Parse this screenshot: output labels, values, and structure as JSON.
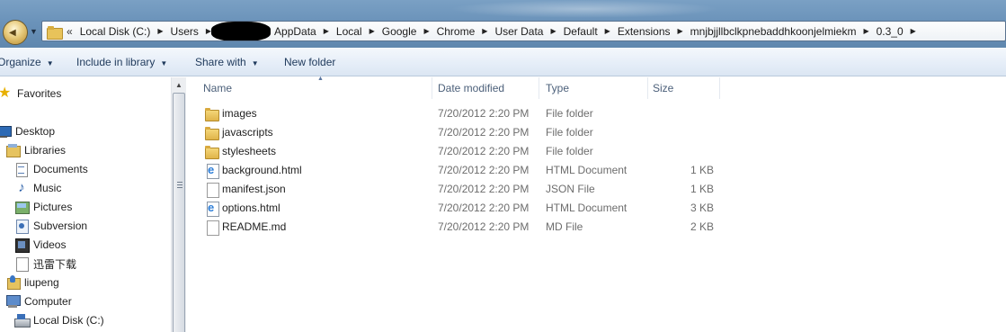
{
  "address": {
    "overflow_glyph": "«",
    "crumbs_before": [
      "Local Disk (C:)",
      "Users"
    ],
    "crumbs_after": [
      "AppData",
      "Local",
      "Google",
      "Chrome",
      "User Data",
      "Default",
      "Extensions",
      "mnjbjjllbclkpnebaddhkoonjelmiekm",
      "0.3_0"
    ],
    "separator": "▶"
  },
  "toolbar": {
    "organize": "Organize",
    "include_in_library": "Include in library",
    "share_with": "Share with",
    "new_folder": "New folder",
    "caret": "▼"
  },
  "sidebar": {
    "favorites": "Favorites",
    "desktop": "Desktop",
    "libraries": "Libraries",
    "documents": "Documents",
    "music": "Music",
    "pictures": "Pictures",
    "subversion": "Subversion",
    "videos": "Videos",
    "xunlei": "迅雷下载",
    "user": "liupeng",
    "computer": "Computer",
    "local_disk": "Local Disk (C:)"
  },
  "columns": {
    "name": "Name",
    "date_modified": "Date modified",
    "type": "Type",
    "size": "Size"
  },
  "files": [
    {
      "name": "images",
      "date": "7/20/2012 2:20 PM",
      "type": "File folder",
      "size": "",
      "icon": "folder-icon"
    },
    {
      "name": "javascripts",
      "date": "7/20/2012 2:20 PM",
      "type": "File folder",
      "size": "",
      "icon": "folder-icon"
    },
    {
      "name": "stylesheets",
      "date": "7/20/2012 2:20 PM",
      "type": "File folder",
      "size": "",
      "icon": "folder-icon"
    },
    {
      "name": "background.html",
      "date": "7/20/2012 2:20 PM",
      "type": "HTML Document",
      "size": "1 KB",
      "icon": "html-file-icon"
    },
    {
      "name": "manifest.json",
      "date": "7/20/2012 2:20 PM",
      "type": "JSON File",
      "size": "1 KB",
      "icon": "file-icon"
    },
    {
      "name": "options.html",
      "date": "7/20/2012 2:20 PM",
      "type": "HTML Document",
      "size": "3 KB",
      "icon": "html-file-icon"
    },
    {
      "name": "README.md",
      "date": "7/20/2012 2:20 PM",
      "type": "MD File",
      "size": "2 KB",
      "icon": "file-icon"
    }
  ]
}
